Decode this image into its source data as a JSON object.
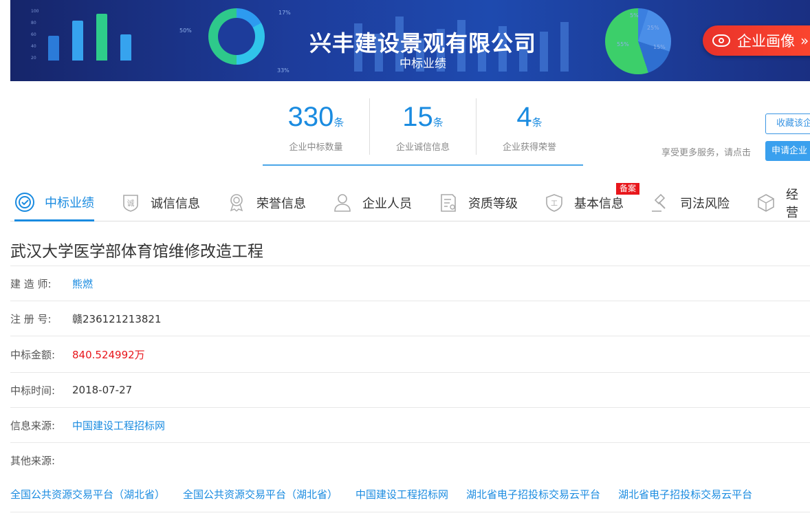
{
  "banner": {
    "company_name": "兴丰建设景观有限公司",
    "subtitle": "中标业绩",
    "portrait_button": "企业画像",
    "portrait_arrows": "»",
    "donut_labels": [
      "17%",
      "50%",
      "33%"
    ],
    "pie_labels": [
      "5%",
      "25%",
      "15%",
      "55%"
    ]
  },
  "stats": [
    {
      "value": "330",
      "unit": "条",
      "label": "企业中标数量"
    },
    {
      "value": "15",
      "unit": "条",
      "label": "企业诚信信息"
    },
    {
      "value": "4",
      "unit": "条",
      "label": "企业获得荣誉"
    }
  ],
  "side": {
    "favorite_button": "收藏该企",
    "more_services_text": "享受更多服务，请点击",
    "apply_button": "申请企业"
  },
  "tabs": [
    {
      "label": "中标业绩",
      "icon": "target-icon",
      "active": true
    },
    {
      "label": "诚信信息",
      "icon": "shield-integrity-icon"
    },
    {
      "label": "荣誉信息",
      "icon": "medal-icon"
    },
    {
      "label": "企业人员",
      "icon": "user-icon"
    },
    {
      "label": "资质等级",
      "icon": "certificate-icon"
    },
    {
      "label": "基本信息",
      "icon": "badge-icon"
    },
    {
      "label": "司法风险",
      "icon": "gavel-icon"
    },
    {
      "label": "经营",
      "icon": "cube-icon"
    }
  ],
  "tab_badge": "备案",
  "detail": {
    "title": "武汉大学医学部体育馆维修改造工程",
    "fields": [
      {
        "key": "建 造 师:",
        "value": "熊燃"
      },
      {
        "key": "注 册 号:",
        "value": "赣236121213821"
      },
      {
        "key": "中标金额:",
        "value": "840.524992万"
      },
      {
        "key": "中标时间:",
        "value": "2018-07-27"
      },
      {
        "key": "信息来源:",
        "value": "中国建设工程招标网"
      },
      {
        "key": "其他来源:",
        "value": ""
      }
    ],
    "other_sources": [
      "全国公共资源交易平台（湖北省）",
      "全国公共资源交易平台（湖北省）",
      "中国建设工程招标网",
      "湖北省电子招投标交易云平台",
      "湖北省电子招投标交易云平台"
    ]
  },
  "colors": {
    "accent": "#1a8be0",
    "money": "#e8161b",
    "banner": "#1d3c9b",
    "portrait": "#f03a2c"
  }
}
